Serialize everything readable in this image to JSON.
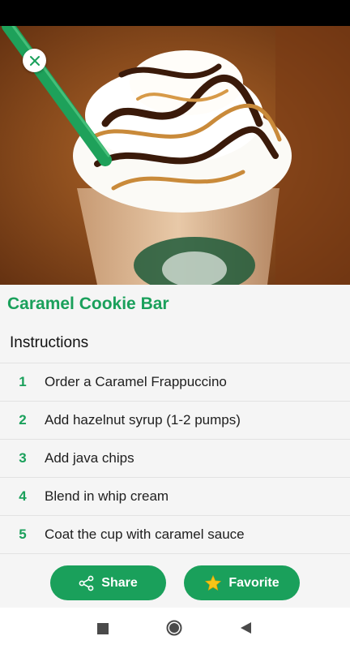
{
  "recipe": {
    "title": "Caramel Cookie Bar",
    "image_alt": "Caramel Frappuccino with whipped cream and caramel drizzle"
  },
  "instructions": {
    "header": "Instructions",
    "steps": [
      {
        "num": "1",
        "text": "Order a Caramel Frappuccino"
      },
      {
        "num": "2",
        "text": "Add hazelnut syrup (1-2 pumps)"
      },
      {
        "num": "3",
        "text": "Add java chips"
      },
      {
        "num": "4",
        "text": "Blend in whip cream"
      },
      {
        "num": "5",
        "text": "Coat the cup with caramel sauce"
      }
    ]
  },
  "actions": {
    "share_label": "Share",
    "share_icon": "share-icon",
    "favorite_label": "Favorite",
    "favorite_icon": "star-icon"
  },
  "colors": {
    "accent": "#1aa05b",
    "star": "#f5c518"
  },
  "icons": {
    "close": "close-icon",
    "nav_back": "back-triangle-icon",
    "nav_home": "home-circle-icon",
    "nav_recents": "recents-square-icon"
  }
}
